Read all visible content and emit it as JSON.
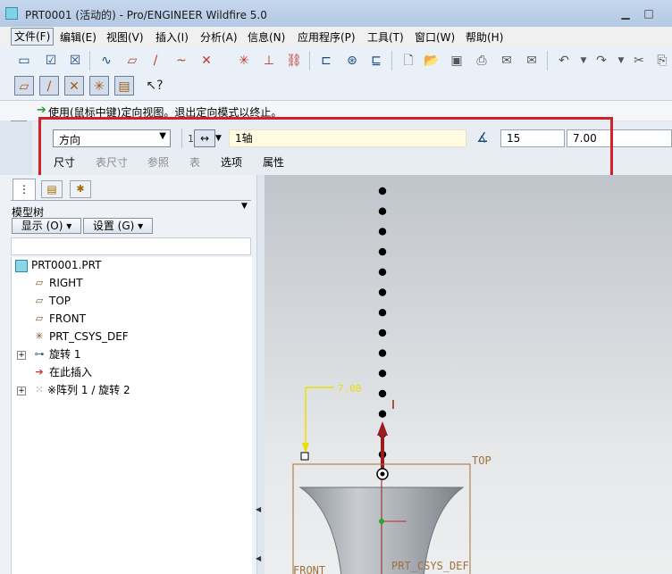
{
  "window": {
    "title": "PRT0001 (活动的) - Pro/ENGINEER Wildfire 5.0"
  },
  "menubar": {
    "items": [
      "文件(F)",
      "编辑(E)",
      "视图(V)",
      "插入(I)",
      "分析(A)",
      "信息(N)",
      "应用程序(P)",
      "工具(T)",
      "窗口(W)",
      "帮助(H)"
    ]
  },
  "message": {
    "text": "使用(鼠标中键)定向视图。退出定向模式以终止。"
  },
  "dashboard": {
    "type_select": "方向",
    "count_prefix": "1",
    "axis_ref": "1轴",
    "count_value": "15",
    "angle_value": "7.00",
    "tabs": [
      "尺寸",
      "表尺寸",
      "参照",
      "表",
      "选项",
      "属性"
    ],
    "tabs_enabled": [
      true,
      false,
      false,
      false,
      true,
      true
    ]
  },
  "left_panel": {
    "tree_title": "模型树",
    "show_button": "显示 (O)",
    "settings_button": "设置 (G)",
    "items": [
      {
        "label": "PRT0001.PRT",
        "icon": "part-icon"
      },
      {
        "label": "RIGHT",
        "icon": "datum-plane-icon"
      },
      {
        "label": "TOP",
        "icon": "datum-plane-icon"
      },
      {
        "label": "FRONT",
        "icon": "datum-plane-icon"
      },
      {
        "label": "PRT_CSYS_DEF",
        "icon": "csys-icon"
      },
      {
        "label": "旋转 1",
        "icon": "revolve-icon"
      },
      {
        "label": "在此插入",
        "icon": "insert-here-arrow-icon"
      },
      {
        "label": "※阵列 1 / 旋转 2",
        "icon": "pattern-icon"
      }
    ]
  },
  "graphics": {
    "dim_label": "7.00",
    "top_label": "TOP",
    "csys_label": "PRT_CSYS_DEF",
    "front_label": "FRONT",
    "dot_count": 15
  },
  "colors": {
    "highlight_box": "#d2212b",
    "dimension": "#e8e000",
    "datum": "#a2703a",
    "axis": "#9b1c1c"
  }
}
